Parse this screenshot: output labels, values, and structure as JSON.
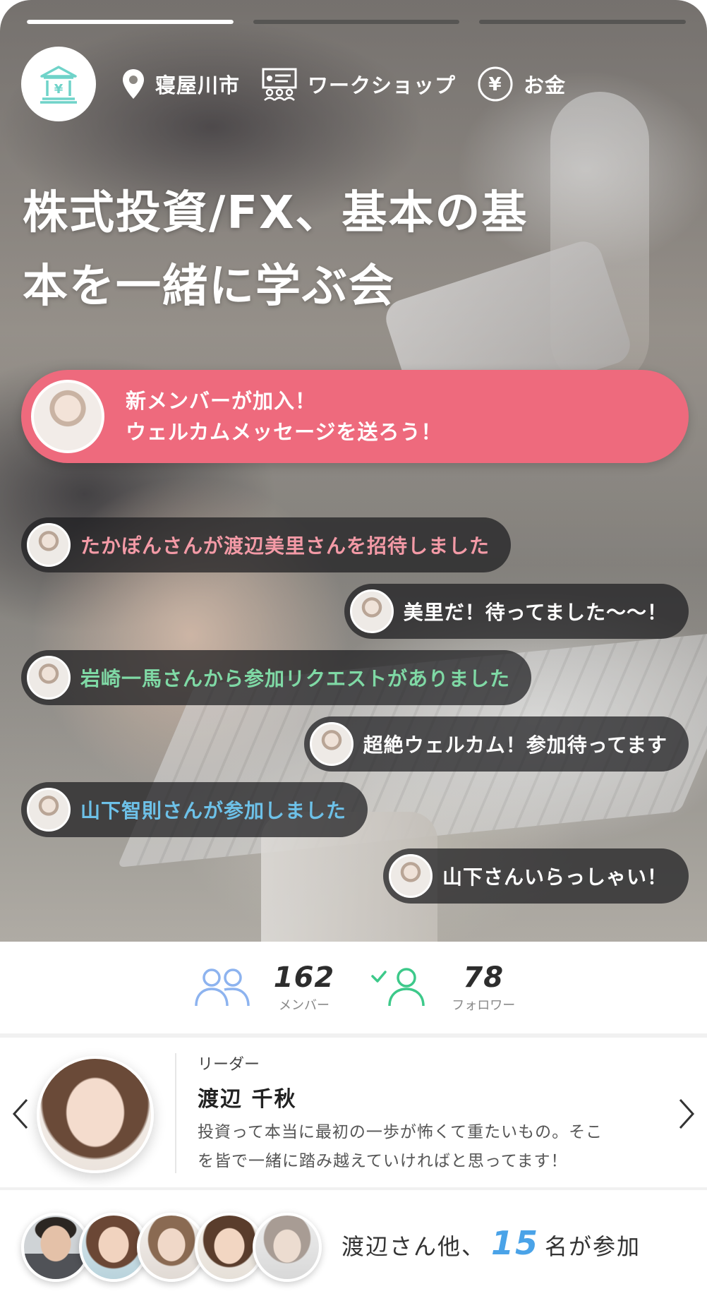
{
  "story": {
    "progress": [
      1.0,
      0.0,
      0.0
    ]
  },
  "header": {
    "location": "寝屋川市",
    "category": "ワークショップ",
    "topic": "お金"
  },
  "title": {
    "line1": "株式投資/FX、基本の基",
    "line2": "本を一緒に学ぶ会"
  },
  "highlight": {
    "line1": "新メンバーが加入！",
    "line2": "ウェルカムメッセージを送ろう！"
  },
  "feed": [
    {
      "text": "たかぽんさんが渡辺美里さんを招待しました",
      "side": "left",
      "color": "pink"
    },
    {
      "text": "美里だ！待ってました〜〜！",
      "side": "right",
      "color": "white"
    },
    {
      "text": "岩崎一馬さんから参加リクエストがありました",
      "side": "left",
      "color": "green"
    },
    {
      "text": "超絶ウェルカム！参加待ってます",
      "side": "right",
      "color": "white"
    },
    {
      "text": "山下智則さんが参加しました",
      "side": "left",
      "color": "blue"
    },
    {
      "text": "山下さんいらっしゃい！",
      "side": "right",
      "color": "white"
    }
  ],
  "stats": {
    "members": {
      "value": "162",
      "label": "メンバー"
    },
    "followers": {
      "value": "78",
      "label": "フォロワー"
    }
  },
  "leader": {
    "role": "リーダー",
    "name": "渡辺 千秋",
    "message_line1": "投資って本当に最初の一歩が怖くて重たいもの。そこ",
    "message_line2": "を皆で一緒に踏み越えていければと思ってます！"
  },
  "participants": {
    "prefix": "渡辺さん他、",
    "count": "15",
    "suffix": "名が参加"
  },
  "colors": {
    "highlight": "#ee6a7d",
    "members_icon": "#8db3ef",
    "followers_icon": "#3dc98a",
    "count": "#4aa3e8",
    "logo_icon": "#6fd3c9"
  }
}
